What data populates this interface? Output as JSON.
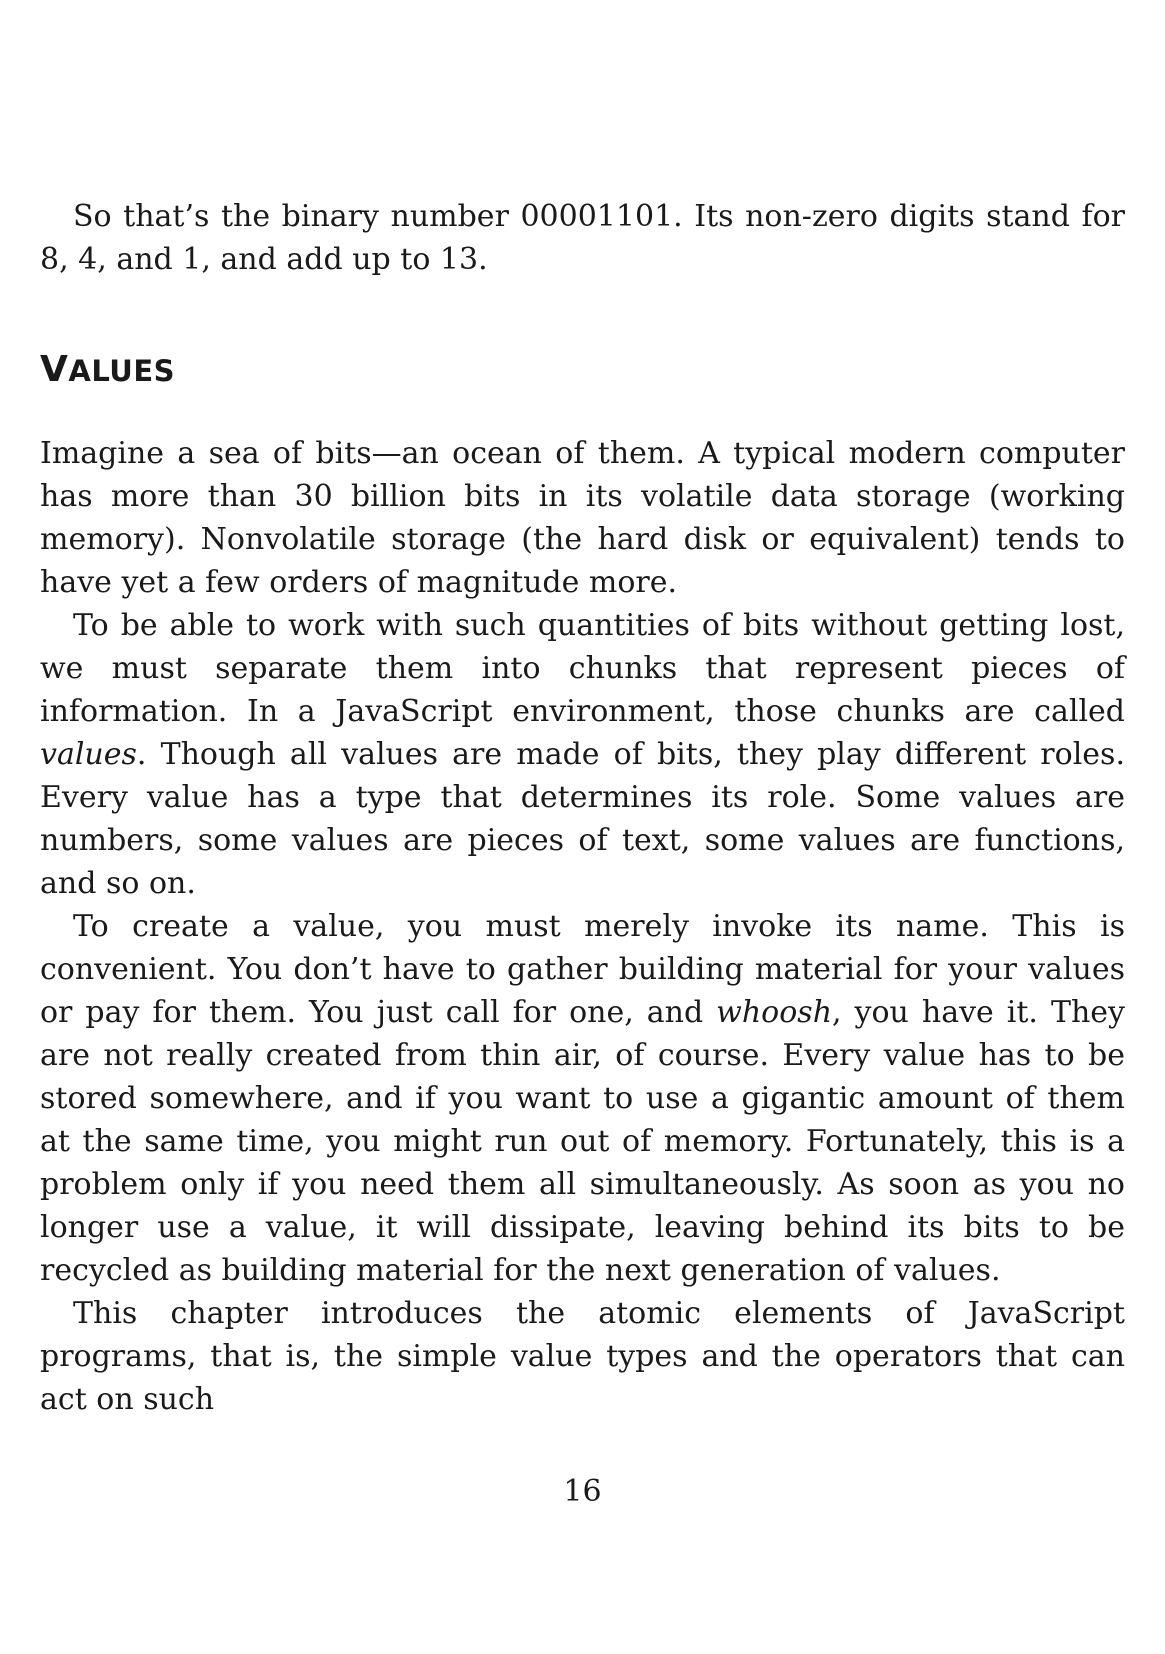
{
  "page": {
    "lead_paragraph": "So that’s the binary number 00001101. Its non-zero digits stand for 8, 4, and 1, and add up to 13.",
    "section_heading": {
      "first_letter": "V",
      "rest": "ALUES"
    },
    "paragraphs": [
      {
        "text": "Imagine a sea of bits—an ocean of them. A typical modern computer has more than 30 billion bits in its volatile data storage (working memory). Nonvolatile storage (the hard disk or equivalent) tends to have yet a few orders of magnitude more."
      },
      {
        "before": "To be able to work with such quantities of bits without getting lost, we must separate them into chunks that represent pieces of information. In a JavaScript environment, those chunks are called ",
        "emphasis": "values",
        "after": ". Though all values are made of bits, they play different roles. Every value has a type that determines its role. Some values are numbers, some values are pieces of text, some values are functions, and so on."
      },
      {
        "before": "To create a value, you must merely invoke its name. This is convenient. You don’t have to gather building material for your values or pay for them. You just call for one, and ",
        "emphasis": "whoosh",
        "after": ", you have it. They are not really created from thin air, of course. Every value has to be stored somewhere, and if you want to use a gigantic amount of them at the same time, you might run out of memory. Fortunately, this is a problem only if you need them all simultaneously. As soon as you no longer use a value, it will dissipate, leaving behind its bits to be recycled as building material for the next generation of values."
      },
      {
        "text": "This chapter introduces the atomic elements of JavaScript programs, that is, the simple value types and the operators that can act on such"
      }
    ],
    "page_number": "16"
  }
}
